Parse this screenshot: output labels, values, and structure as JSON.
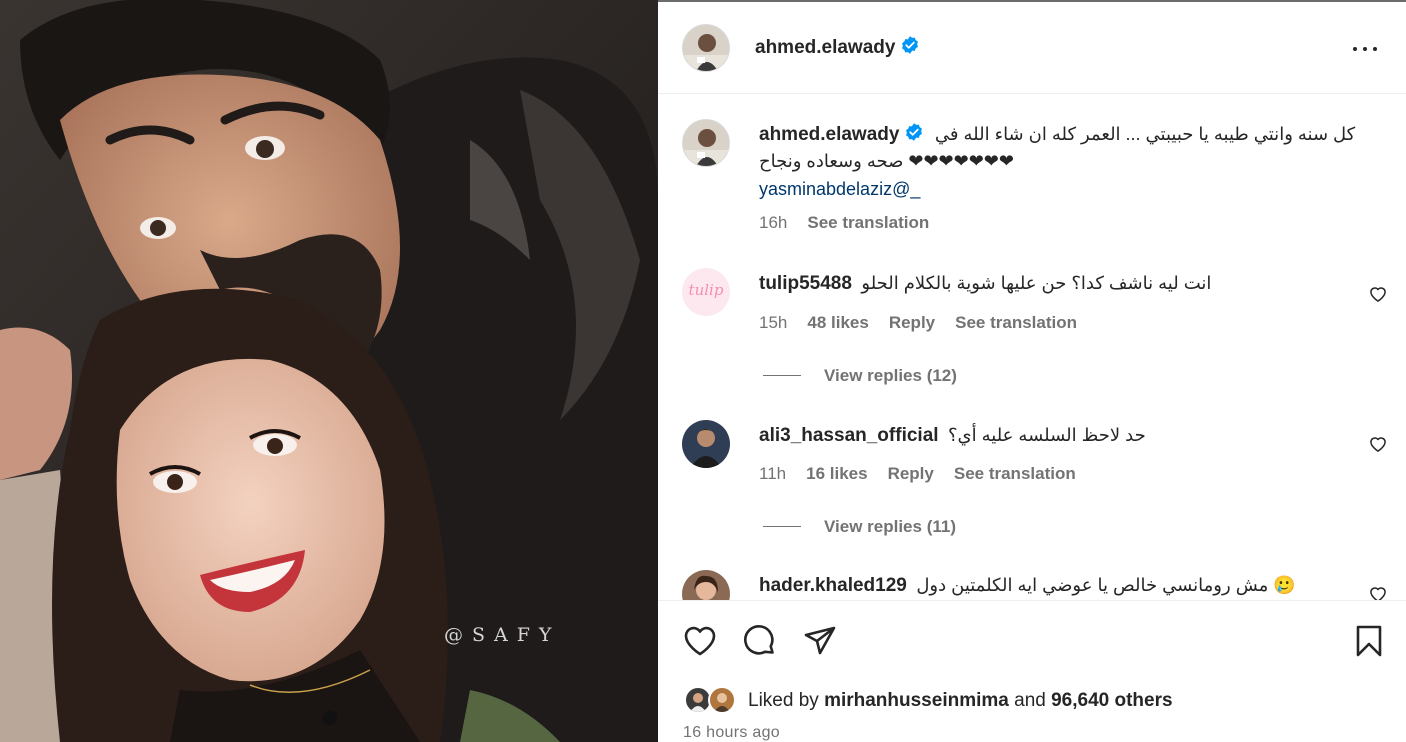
{
  "media": {
    "watermark": "@SAFY"
  },
  "header": {
    "username": "ahmed.elawady",
    "verified": true,
    "more_icon": "more-horizontal-icon"
  },
  "caption": {
    "username": "ahmed.elawady",
    "verified": true,
    "text_line1": "كل سنه وانتي طيبه يا حبيبتي ... العمر كله ان شاء الله في",
    "text_line2": "صحه وسعاده ونجاح ❤❤❤❤❤❤❤",
    "mention": "yasminabdelaziz@_",
    "time": "16h",
    "see_translation": "See translation"
  },
  "comments": [
    {
      "username": "tulip55488",
      "avatar_text": "tulip",
      "text": "انت ليه ناشف كدا؟ حن عليها شوية بالكلام الحلو",
      "time": "15h",
      "likes": "48 likes",
      "reply": "Reply",
      "see_translation": "See translation",
      "view_replies": "View replies (12)"
    },
    {
      "username": "ali3_hassan_official",
      "text": "حد لاحظ السلسه عليه أي؟",
      "time": "11h",
      "likes": "16 likes",
      "reply": "Reply",
      "see_translation": "See translation",
      "view_replies": "View replies (11)"
    },
    {
      "username": "hader.khaled129",
      "text": "مش رومانسي خالص يا عوضي ايه الكلمتين دول 🥲"
    }
  ],
  "actions": {
    "like_icon": "heart-icon",
    "comment_icon": "comment-icon",
    "share_icon": "paper-plane-icon",
    "save_icon": "bookmark-icon"
  },
  "likes": {
    "prefix": "Liked by",
    "user": "mirhanhusseinmima",
    "joiner": "and",
    "others": "96,640 others"
  },
  "posted": "16 hours ago",
  "colors": {
    "verified": "#0095f6",
    "mention": "#00376b",
    "secondary_text": "#737373",
    "tulip_avatar_text": "#f48fb1"
  }
}
